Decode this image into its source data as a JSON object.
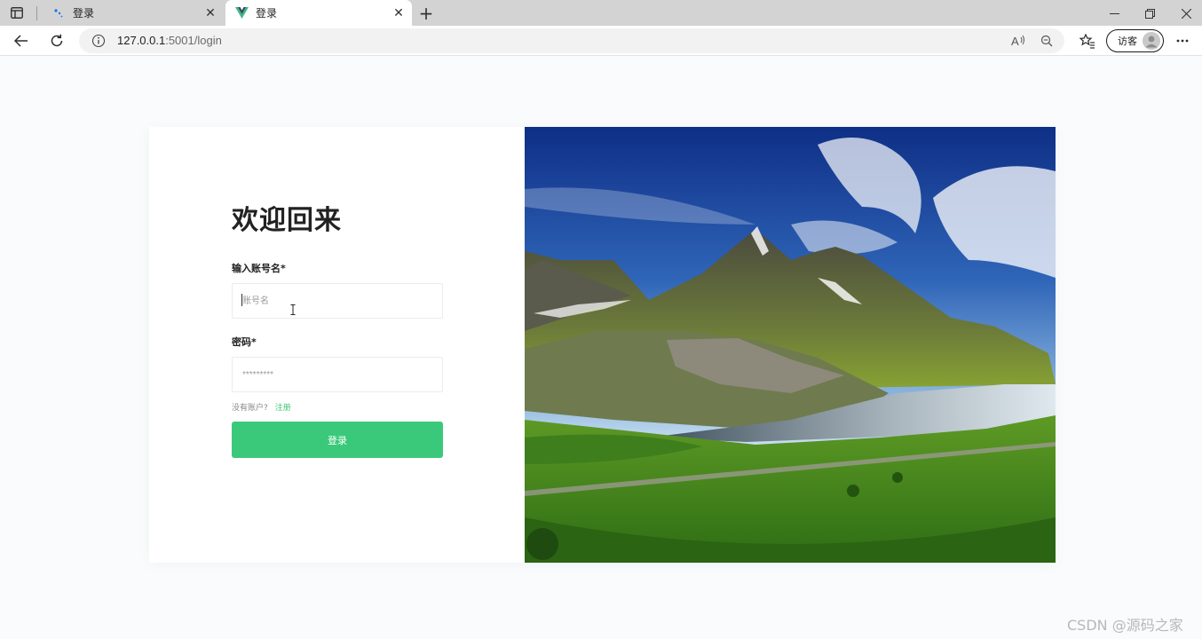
{
  "browser": {
    "tabs": [
      {
        "title": "登录",
        "state": "inactive"
      },
      {
        "title": "登录",
        "state": "active"
      }
    ],
    "address": {
      "host": "127.0.0.1",
      "rest": ":5001/login"
    },
    "guest_label": "访客"
  },
  "login": {
    "heading": "欢迎回来",
    "account_label": "输入账号名*",
    "account_placeholder": "账号名",
    "password_label": "密码*",
    "password_placeholder": "*********",
    "no_account_text": "没有账户?",
    "register_link": "注册",
    "submit_label": "登录"
  },
  "colors": {
    "accent": "#3ac97a",
    "link": "#3bc878"
  },
  "watermark": "CSDN @源码之家"
}
